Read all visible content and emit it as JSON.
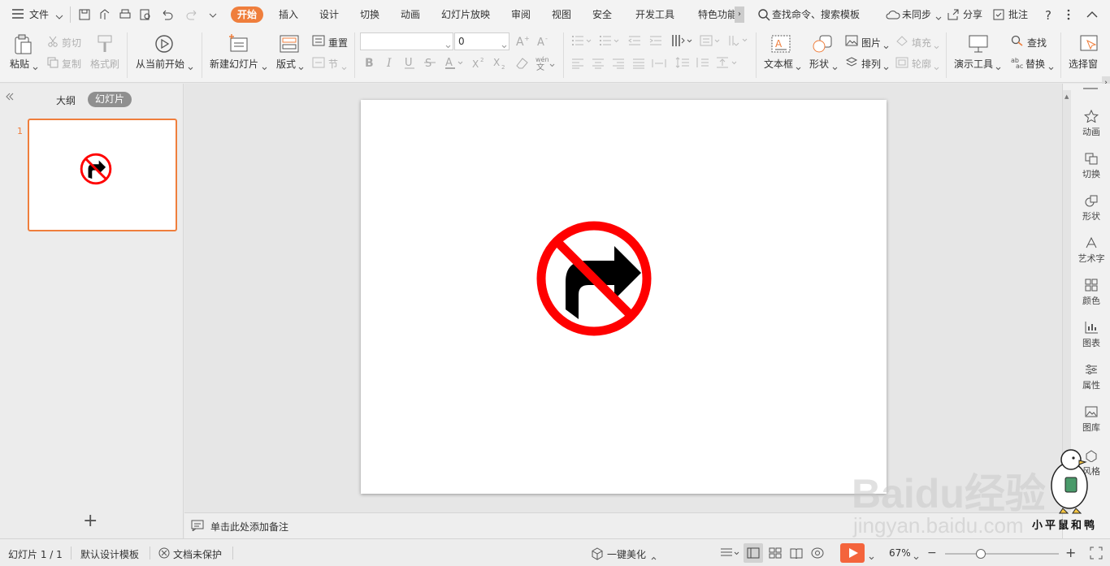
{
  "menubar": {
    "file_label": "文件",
    "tabs": [
      "开始",
      "插入",
      "设计",
      "切换",
      "动画",
      "幻灯片放映",
      "审阅",
      "视图",
      "安全",
      "开发工具",
      "特色功能"
    ],
    "search_label": "查找命令、搜索模板",
    "sync_label": "未同步",
    "share_label": "分享",
    "comment_label": "批注"
  },
  "ribbon": {
    "paste": "粘贴",
    "cut": "剪切",
    "copy": "复制",
    "format_painter": "格式刷",
    "from_current": "从当前开始",
    "new_slide": "新建幻灯片",
    "layout": "版式",
    "reset": "重置",
    "section": "节",
    "font_size_value": "0",
    "textbox": "文本框",
    "shape": "形状",
    "picture": "图片",
    "fill": "填充",
    "arrange": "排列",
    "outline": "轮廓",
    "present_tools": "演示工具",
    "find": "查找",
    "replace": "替换",
    "select_pane": "选择窗"
  },
  "leftpanel": {
    "tab_outline": "大纲",
    "tab_slides": "幻灯片",
    "slide_number": "1",
    "add_symbol": "+"
  },
  "notes": {
    "placeholder": "单击此处添加备注"
  },
  "rightbar": {
    "items": [
      "动画",
      "切换",
      "形状",
      "艺术字",
      "颜色",
      "图表",
      "属性",
      "图库",
      "风格"
    ]
  },
  "statusbar": {
    "slide_info": "幻灯片 1 / 1",
    "template": "默认设计模板",
    "protect": "文档未保护",
    "beautify": "一键美化",
    "zoom": "67%"
  },
  "watermark": {
    "brand": "Baidu经验",
    "url": "jingyan.baidu.com",
    "sticker_text": "小平鼠和鸭"
  },
  "colors": {
    "accent": "#ef7e3c",
    "sign_red": "#ff0000",
    "play": "#f4643c"
  }
}
